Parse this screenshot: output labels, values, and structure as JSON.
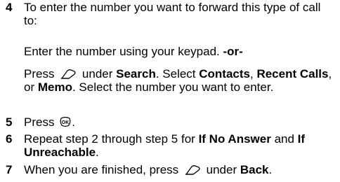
{
  "steps": [
    {
      "number": "4",
      "text": "To enter the number you want to forward this type of call to:",
      "options": [
        {
          "lead": "Enter the number using your keypad. ",
          "bold": "-or-"
        },
        {
          "pre": "Press ",
          "mid": " under ",
          "search": "Search",
          "sep1": ". Select ",
          "contacts": "Contacts",
          "sep2": ", ",
          "recent": "Recent Calls",
          "sep3": ", or ",
          "memo": "Memo",
          "tail": ". Select the number you want to enter."
        }
      ]
    },
    {
      "number": "5",
      "pre": "Press ",
      "tail": "."
    },
    {
      "number": "6",
      "pre": "Repeat step 2 through step 5 for ",
      "bold1": "If No Answer",
      "mid": " and ",
      "bold2": "If Unreachable",
      "tail": "."
    },
    {
      "number": "7",
      "pre": "When you are finished, press ",
      "mid": " under ",
      "bold": "Back",
      "tail": "."
    }
  ],
  "icons": {
    "softkey": "softkey-icon",
    "ok": "ok-key-icon"
  }
}
